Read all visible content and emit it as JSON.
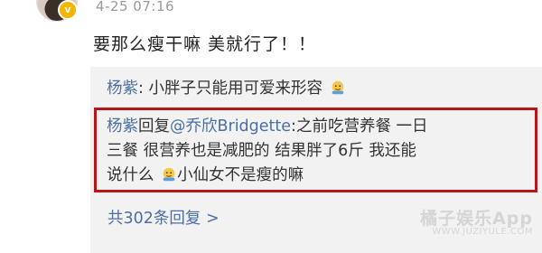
{
  "comment": {
    "timestamp": "4-25 07:16",
    "text": "要那么瘦干嘛 美就行了！！"
  },
  "replies": [
    {
      "author": "杨紫",
      "text": ": 小胖子只能用可爱来形容",
      "emoji": "sweat-hug-emoji"
    },
    {
      "author": "杨紫",
      "reply_word": "回复",
      "mention": "@乔欣Bridgette",
      "line1_text": ":之前吃营养餐 一日",
      "line2_text": "三餐 很营养也是减肥的 结果胖了6斤 我还能",
      "line3_before_emoji": "说什么",
      "line3_after_emoji": "小仙女不是瘦的嘛",
      "emoji": "sweat-hug-emoji"
    }
  ],
  "more_replies": "共302条回复 >",
  "watermark": {
    "main": "橘子娱乐App",
    "sub": "WWW.JUZIYULE.COM"
  },
  "colors": {
    "link": "#4a6fa5",
    "highlight_border": "#b5161a",
    "reply_background": "#f2f2f2"
  }
}
